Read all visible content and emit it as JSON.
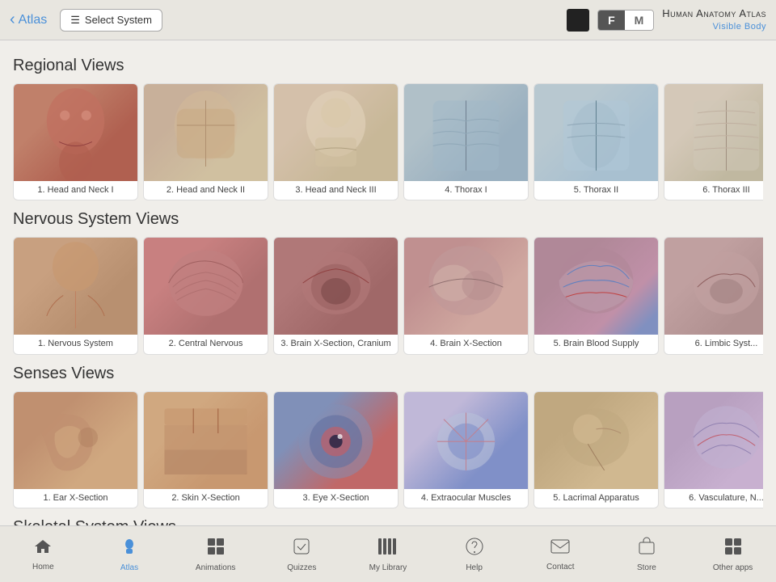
{
  "header": {
    "back_label": "Atlas",
    "select_system_label": "Select System",
    "gender_f": "F",
    "gender_m": "M",
    "app_title": "Human Anatomy Atlas",
    "app_subtitle": "Visible Body"
  },
  "sections": [
    {
      "id": "regional-views",
      "title": "Regional Views",
      "items": [
        {
          "number": 1,
          "label": "Head and Neck I",
          "color_class": "anat-head1"
        },
        {
          "number": 2,
          "label": "Head and Neck II",
          "color_class": "anat-head2"
        },
        {
          "number": 3,
          "label": "Head and Neck III",
          "color_class": "anat-head3"
        },
        {
          "number": 4,
          "label": "Thorax I",
          "color_class": "anat-thorax1"
        },
        {
          "number": 5,
          "label": "Thorax II",
          "color_class": "anat-thorax2"
        },
        {
          "number": 6,
          "label": "Thorax III",
          "color_class": "anat-thorax3"
        }
      ]
    },
    {
      "id": "nervous-system-views",
      "title": "Nervous System Views",
      "items": [
        {
          "number": 1,
          "label": "Nervous System",
          "color_class": "anat-nervous1"
        },
        {
          "number": 2,
          "label": "Central Nervous",
          "color_class": "anat-brain1"
        },
        {
          "number": 3,
          "label": "Brain X-Section, Cranium",
          "color_class": "anat-brain2"
        },
        {
          "number": 4,
          "label": "Brain X-Section",
          "color_class": "anat-brain3"
        },
        {
          "number": 5,
          "label": "Brain Blood Supply",
          "color_class": "anat-brain4"
        },
        {
          "number": 6,
          "label": "Limbic Syst...",
          "color_class": "anat-limbic"
        }
      ]
    },
    {
      "id": "senses-views",
      "title": "Senses Views",
      "items": [
        {
          "number": 1,
          "label": "Ear X-Section",
          "color_class": "anat-ear"
        },
        {
          "number": 2,
          "label": "Skin X-Section",
          "color_class": "anat-skin"
        },
        {
          "number": 3,
          "label": "Eye X-Section",
          "color_class": "anat-eye1"
        },
        {
          "number": 4,
          "label": "Extraocular Muscles",
          "color_class": "anat-eye2"
        },
        {
          "number": 5,
          "label": "Lacrimal Apparatus",
          "color_class": "anat-lacrimal"
        },
        {
          "number": 6,
          "label": "Vasculature, N...",
          "color_class": "anat-vasc"
        }
      ]
    },
    {
      "id": "skeletal-system-views",
      "title": "Skeletal System Views",
      "items": []
    }
  ],
  "bottom_nav": [
    {
      "id": "home",
      "label": "Home",
      "icon": "🏠",
      "active": false
    },
    {
      "id": "atlas",
      "label": "Atlas",
      "icon": "👤",
      "active": true
    },
    {
      "id": "animations",
      "label": "Animations",
      "icon": "⊞",
      "active": false
    },
    {
      "id": "quizzes",
      "label": "Quizzes",
      "icon": "✓",
      "active": false
    },
    {
      "id": "my-library",
      "label": "My Library",
      "icon": "▌▌",
      "active": false
    },
    {
      "id": "help",
      "label": "Help",
      "icon": "?",
      "active": false
    },
    {
      "id": "contact",
      "label": "Contact",
      "icon": "✉",
      "active": false
    },
    {
      "id": "store",
      "label": "Store",
      "icon": "🏷",
      "active": false
    },
    {
      "id": "other-apps",
      "label": "Other apps",
      "icon": "⊞",
      "active": false
    }
  ]
}
